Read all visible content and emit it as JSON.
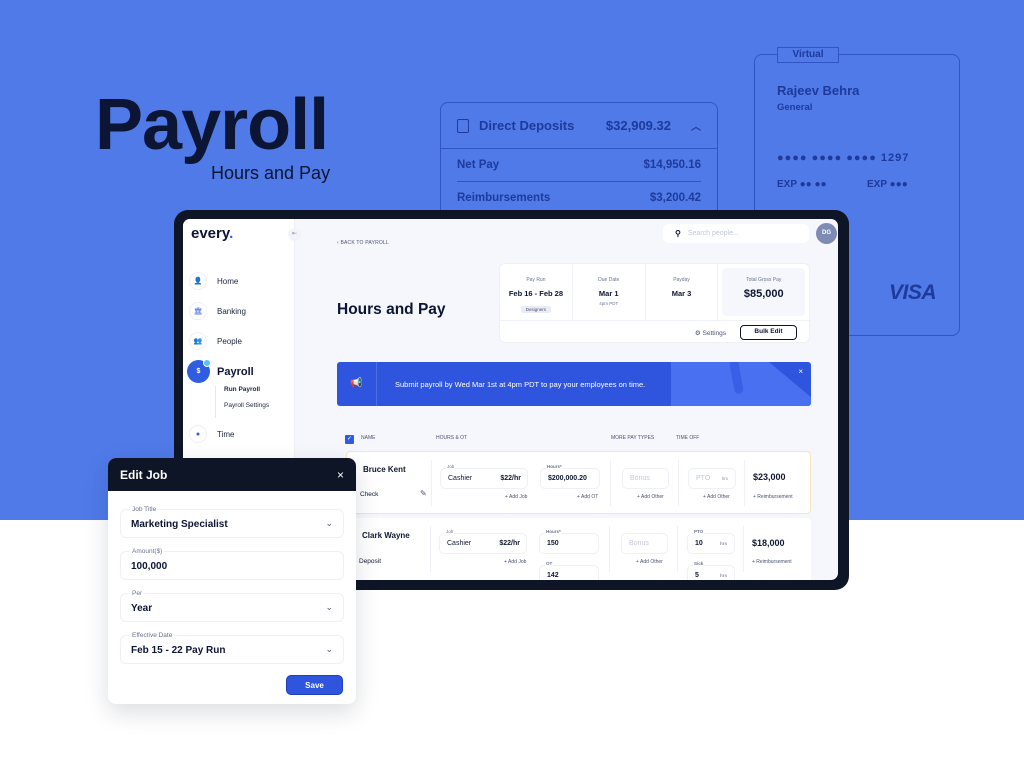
{
  "hero": {
    "title": "Payroll",
    "subtitle": "Hours and Pay"
  },
  "direct_deposits": {
    "label": "Direct Deposits",
    "total": "$32,909.32",
    "rows": [
      {
        "label": "Net Pay",
        "value": "$14,950.16"
      },
      {
        "label": "Reimbursements",
        "value": "$3,200.42"
      }
    ]
  },
  "virtual_card": {
    "tag": "Virtual",
    "name": "Rajeev Behra",
    "type": "General",
    "number": "●●●● ●●●● ●●●● 1297",
    "exp1": "EXP  ●● ●●",
    "exp2": "EXP  ●●●",
    "brand": "VISA"
  },
  "app": {
    "logo": "every",
    "logo_dot": ".",
    "collapse_icon": "⇤",
    "sidebar": {
      "items": [
        {
          "label": "Home",
          "icon": "👤"
        },
        {
          "label": "Banking",
          "icon": "🏛"
        },
        {
          "label": "People",
          "icon": "👥"
        },
        {
          "label": "Payroll",
          "icon": "$"
        },
        {
          "label": "Time",
          "icon": "●"
        }
      ],
      "subitems": [
        "Run Payroll",
        "Payroll Settings"
      ]
    },
    "back_link": "‹  BACK TO PAYROLL",
    "search": {
      "placeholder": "Search people...",
      "icon": "⚲"
    },
    "avatar": "DG",
    "page_title": "Hours and Pay",
    "summary": {
      "pay_run": {
        "label": "Pay Run",
        "value": "Feb 16 - Feb 28",
        "chip": "Designers"
      },
      "due_date": {
        "label": "Due Date",
        "value": "Mar 1",
        "sub": "4pm PDT"
      },
      "payday": {
        "label": "Payday",
        "value": "Mar 3"
      },
      "total": {
        "label": "Total Gross Pay",
        "value": "$85,000"
      },
      "settings": "⚙ Settings",
      "bulk_edit": "Bulk Edit"
    },
    "banner": {
      "icon": "📢",
      "message": "Submit payroll by Wed Mar 1st at 4pm PDT to pay your employees on time.",
      "close": "×"
    },
    "table": {
      "check": "✓",
      "headers": {
        "name": "NAME",
        "hours": "HOURS & OT",
        "more": "MORE PAY TYPES",
        "timeoff": "TIME OFF"
      },
      "rows": [
        {
          "name": "Bruce Kent",
          "pay_method": "Check",
          "job_label": "Job",
          "job": "Cashier",
          "rate": "$22/hr",
          "hours_label": "Hours*",
          "hours": "$200,000.20",
          "add_job": "+ Add Job",
          "add_ot": "+ Add OT",
          "bonus": "Bonus",
          "add_other": "+ Add Other",
          "pto": "PTO",
          "hrs": "hrs",
          "add_other2": "+ Add Other",
          "total": "$23,000",
          "reimb": "+ Reimbursement"
        },
        {
          "name": "Clark Wayne",
          "pay_method": "Deposit",
          "job_label": "Job",
          "job": "Cashier",
          "rate": "$22/hr",
          "hours_label": "Hours*",
          "hours": "150",
          "ot_label": "OT",
          "ot": "142",
          "add_job": "+ Add Job",
          "bonus": "Bonus",
          "add_other": "+ Add Other",
          "pto_label": "PTO",
          "pto": "10",
          "hrs": "hrs",
          "sick_label": "Sick",
          "sick": "5",
          "total": "$18,000",
          "reimb": "+ Reimbursement"
        }
      ]
    }
  },
  "edit_job": {
    "title": "Edit Job",
    "close": "×",
    "fields": [
      {
        "label": "Job Title",
        "value": "Marketing Specialist",
        "dropdown": true
      },
      {
        "label": "Amount($)",
        "value": "100,000",
        "dropdown": false
      },
      {
        "label": "Per",
        "value": "Year",
        "dropdown": true
      },
      {
        "label": "Effective Date",
        "value": "Feb 15 - 22 Pay Run",
        "dropdown": true
      }
    ],
    "chevron": "⌄",
    "save": "Save"
  }
}
